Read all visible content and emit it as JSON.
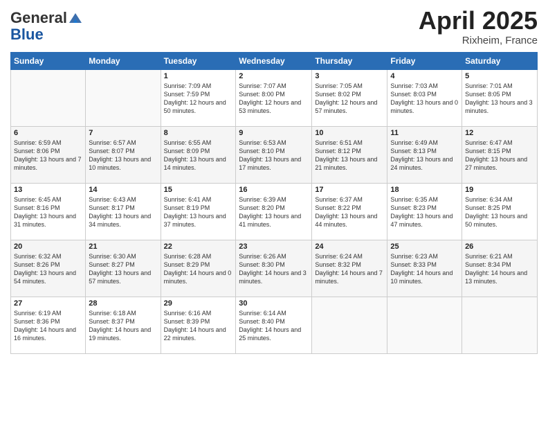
{
  "header": {
    "logo_general": "General",
    "logo_blue": "Blue",
    "month_title": "April 2025",
    "location": "Rixheim, France"
  },
  "days_of_week": [
    "Sunday",
    "Monday",
    "Tuesday",
    "Wednesday",
    "Thursday",
    "Friday",
    "Saturday"
  ],
  "weeks": [
    [
      {
        "day": "",
        "sunrise": "",
        "sunset": "",
        "daylight": ""
      },
      {
        "day": "",
        "sunrise": "",
        "sunset": "",
        "daylight": ""
      },
      {
        "day": "1",
        "sunrise": "Sunrise: 7:09 AM",
        "sunset": "Sunset: 7:59 PM",
        "daylight": "Daylight: 12 hours and 50 minutes."
      },
      {
        "day": "2",
        "sunrise": "Sunrise: 7:07 AM",
        "sunset": "Sunset: 8:00 PM",
        "daylight": "Daylight: 12 hours and 53 minutes."
      },
      {
        "day": "3",
        "sunrise": "Sunrise: 7:05 AM",
        "sunset": "Sunset: 8:02 PM",
        "daylight": "Daylight: 12 hours and 57 minutes."
      },
      {
        "day": "4",
        "sunrise": "Sunrise: 7:03 AM",
        "sunset": "Sunset: 8:03 PM",
        "daylight": "Daylight: 13 hours and 0 minutes."
      },
      {
        "day": "5",
        "sunrise": "Sunrise: 7:01 AM",
        "sunset": "Sunset: 8:05 PM",
        "daylight": "Daylight: 13 hours and 3 minutes."
      }
    ],
    [
      {
        "day": "6",
        "sunrise": "Sunrise: 6:59 AM",
        "sunset": "Sunset: 8:06 PM",
        "daylight": "Daylight: 13 hours and 7 minutes."
      },
      {
        "day": "7",
        "sunrise": "Sunrise: 6:57 AM",
        "sunset": "Sunset: 8:07 PM",
        "daylight": "Daylight: 13 hours and 10 minutes."
      },
      {
        "day": "8",
        "sunrise": "Sunrise: 6:55 AM",
        "sunset": "Sunset: 8:09 PM",
        "daylight": "Daylight: 13 hours and 14 minutes."
      },
      {
        "day": "9",
        "sunrise": "Sunrise: 6:53 AM",
        "sunset": "Sunset: 8:10 PM",
        "daylight": "Daylight: 13 hours and 17 minutes."
      },
      {
        "day": "10",
        "sunrise": "Sunrise: 6:51 AM",
        "sunset": "Sunset: 8:12 PM",
        "daylight": "Daylight: 13 hours and 21 minutes."
      },
      {
        "day": "11",
        "sunrise": "Sunrise: 6:49 AM",
        "sunset": "Sunset: 8:13 PM",
        "daylight": "Daylight: 13 hours and 24 minutes."
      },
      {
        "day": "12",
        "sunrise": "Sunrise: 6:47 AM",
        "sunset": "Sunset: 8:15 PM",
        "daylight": "Daylight: 13 hours and 27 minutes."
      }
    ],
    [
      {
        "day": "13",
        "sunrise": "Sunrise: 6:45 AM",
        "sunset": "Sunset: 8:16 PM",
        "daylight": "Daylight: 13 hours and 31 minutes."
      },
      {
        "day": "14",
        "sunrise": "Sunrise: 6:43 AM",
        "sunset": "Sunset: 8:17 PM",
        "daylight": "Daylight: 13 hours and 34 minutes."
      },
      {
        "day": "15",
        "sunrise": "Sunrise: 6:41 AM",
        "sunset": "Sunset: 8:19 PM",
        "daylight": "Daylight: 13 hours and 37 minutes."
      },
      {
        "day": "16",
        "sunrise": "Sunrise: 6:39 AM",
        "sunset": "Sunset: 8:20 PM",
        "daylight": "Daylight: 13 hours and 41 minutes."
      },
      {
        "day": "17",
        "sunrise": "Sunrise: 6:37 AM",
        "sunset": "Sunset: 8:22 PM",
        "daylight": "Daylight: 13 hours and 44 minutes."
      },
      {
        "day": "18",
        "sunrise": "Sunrise: 6:35 AM",
        "sunset": "Sunset: 8:23 PM",
        "daylight": "Daylight: 13 hours and 47 minutes."
      },
      {
        "day": "19",
        "sunrise": "Sunrise: 6:34 AM",
        "sunset": "Sunset: 8:25 PM",
        "daylight": "Daylight: 13 hours and 50 minutes."
      }
    ],
    [
      {
        "day": "20",
        "sunrise": "Sunrise: 6:32 AM",
        "sunset": "Sunset: 8:26 PM",
        "daylight": "Daylight: 13 hours and 54 minutes."
      },
      {
        "day": "21",
        "sunrise": "Sunrise: 6:30 AM",
        "sunset": "Sunset: 8:27 PM",
        "daylight": "Daylight: 13 hours and 57 minutes."
      },
      {
        "day": "22",
        "sunrise": "Sunrise: 6:28 AM",
        "sunset": "Sunset: 8:29 PM",
        "daylight": "Daylight: 14 hours and 0 minutes."
      },
      {
        "day": "23",
        "sunrise": "Sunrise: 6:26 AM",
        "sunset": "Sunset: 8:30 PM",
        "daylight": "Daylight: 14 hours and 3 minutes."
      },
      {
        "day": "24",
        "sunrise": "Sunrise: 6:24 AM",
        "sunset": "Sunset: 8:32 PM",
        "daylight": "Daylight: 14 hours and 7 minutes."
      },
      {
        "day": "25",
        "sunrise": "Sunrise: 6:23 AM",
        "sunset": "Sunset: 8:33 PM",
        "daylight": "Daylight: 14 hours and 10 minutes."
      },
      {
        "day": "26",
        "sunrise": "Sunrise: 6:21 AM",
        "sunset": "Sunset: 8:34 PM",
        "daylight": "Daylight: 14 hours and 13 minutes."
      }
    ],
    [
      {
        "day": "27",
        "sunrise": "Sunrise: 6:19 AM",
        "sunset": "Sunset: 8:36 PM",
        "daylight": "Daylight: 14 hours and 16 minutes."
      },
      {
        "day": "28",
        "sunrise": "Sunrise: 6:18 AM",
        "sunset": "Sunset: 8:37 PM",
        "daylight": "Daylight: 14 hours and 19 minutes."
      },
      {
        "day": "29",
        "sunrise": "Sunrise: 6:16 AM",
        "sunset": "Sunset: 8:39 PM",
        "daylight": "Daylight: 14 hours and 22 minutes."
      },
      {
        "day": "30",
        "sunrise": "Sunrise: 6:14 AM",
        "sunset": "Sunset: 8:40 PM",
        "daylight": "Daylight: 14 hours and 25 minutes."
      },
      {
        "day": "",
        "sunrise": "",
        "sunset": "",
        "daylight": ""
      },
      {
        "day": "",
        "sunrise": "",
        "sunset": "",
        "daylight": ""
      },
      {
        "day": "",
        "sunrise": "",
        "sunset": "",
        "daylight": ""
      }
    ]
  ]
}
